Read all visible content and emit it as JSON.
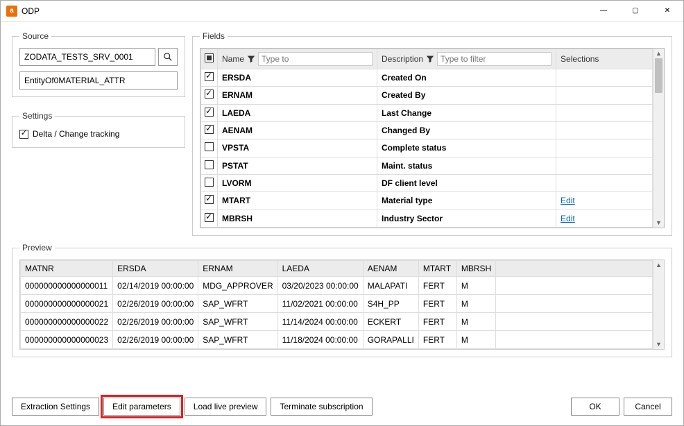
{
  "window": {
    "title": "ODP",
    "icon_letter": "a"
  },
  "source": {
    "legend": "Source",
    "service": "ZODATA_TESTS_SRV_0001",
    "entity": "EntityOf0MATERIAL_ATTR"
  },
  "settings": {
    "legend": "Settings",
    "delta_label": "Delta / Change tracking",
    "delta_checked": true
  },
  "fields": {
    "legend": "Fields",
    "headers": {
      "name": "Name",
      "description": "Description",
      "selections": "Selections",
      "name_filter_placeholder": "Type to",
      "desc_filter_placeholder": "Type to filter"
    },
    "rows": [
      {
        "checked": true,
        "name": "ERSDA",
        "desc": "Created On",
        "sel": ""
      },
      {
        "checked": true,
        "name": "ERNAM",
        "desc": "Created By",
        "sel": ""
      },
      {
        "checked": true,
        "name": "LAEDA",
        "desc": "Last Change",
        "sel": ""
      },
      {
        "checked": true,
        "name": "AENAM",
        "desc": "Changed By",
        "sel": ""
      },
      {
        "checked": false,
        "name": "VPSTA",
        "desc": "Complete status",
        "sel": ""
      },
      {
        "checked": false,
        "name": "PSTAT",
        "desc": "Maint. status",
        "sel": ""
      },
      {
        "checked": false,
        "name": "LVORM",
        "desc": "DF client level",
        "sel": ""
      },
      {
        "checked": true,
        "name": "MTART",
        "desc": "Material type",
        "sel": "Edit"
      },
      {
        "checked": true,
        "name": "MBRSH",
        "desc": "Industry Sector",
        "sel": "Edit"
      }
    ]
  },
  "preview": {
    "legend": "Preview",
    "columns": [
      "MATNR",
      "ERSDA",
      "ERNAM",
      "LAEDA",
      "AENAM",
      "MTART",
      "MBRSH"
    ],
    "rows": [
      [
        "000000000000000011",
        "02/14/2019 00:00:00",
        "MDG_APPROVER",
        "03/20/2023 00:00:00",
        "MALAPATI",
        "FERT",
        "M"
      ],
      [
        "000000000000000021",
        "02/26/2019 00:00:00",
        "SAP_WFRT",
        "11/02/2021 00:00:00",
        "S4H_PP",
        "FERT",
        "M"
      ],
      [
        "000000000000000022",
        "02/26/2019 00:00:00",
        "SAP_WFRT",
        "11/14/2024 00:00:00",
        "ECKERT",
        "FERT",
        "M"
      ],
      [
        "000000000000000023",
        "02/26/2019 00:00:00",
        "SAP_WFRT",
        "11/18/2024 00:00:00",
        "GORAPALLI",
        "FERT",
        "M"
      ]
    ]
  },
  "buttons": {
    "extraction": "Extraction Settings",
    "edit_params": "Edit parameters",
    "load_preview": "Load live preview",
    "terminate": "Terminate subscription",
    "ok": "OK",
    "cancel": "Cancel"
  }
}
